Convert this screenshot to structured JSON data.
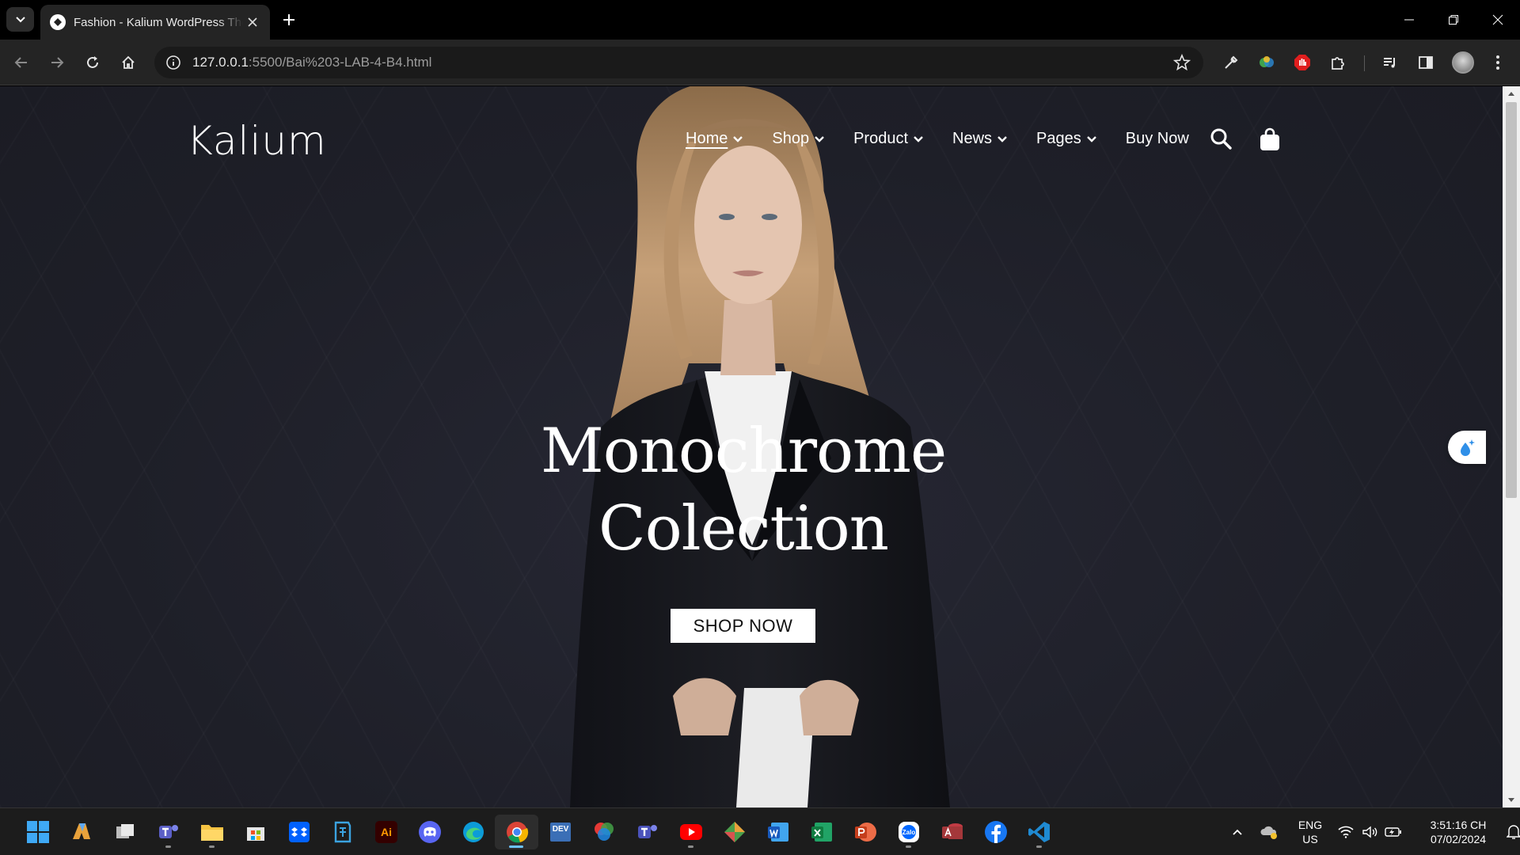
{
  "browser": {
    "tab_title": "Fashion - Kalium WordPress Theme",
    "url_host": "127.0.0.1",
    "url_path": ":5500/Bai%203-LAB-4-B4.html"
  },
  "site": {
    "logo": "Kalium",
    "nav": [
      {
        "label": "Home",
        "dropdown": true,
        "active": true
      },
      {
        "label": "Shop",
        "dropdown": true
      },
      {
        "label": "Product",
        "dropdown": true
      },
      {
        "label": "News",
        "dropdown": true
      },
      {
        "label": "Pages",
        "dropdown": true
      },
      {
        "label": "Buy Now",
        "dropdown": false
      }
    ],
    "hero": {
      "title_line1": "Monochrome",
      "title_line2": "Colection",
      "cta": "SHOP NOW"
    }
  },
  "taskbar": {
    "apps": [
      "windows-start-icon",
      "copilot-icon",
      "task-view-icon",
      "teams-icon",
      "file-explorer-icon",
      "microsoft-store-icon",
      "dropbox-icon",
      "app-icon",
      "illustrator-icon",
      "discord-icon",
      "edge-icon",
      "chrome-icon",
      "devtools-icon",
      "color-app-icon",
      "teams-icon",
      "youtube-icon",
      "git-icon",
      "word-icon",
      "excel-icon",
      "powerpoint-icon",
      "zalo-icon",
      "access-icon",
      "facebook-icon",
      "vscode-icon"
    ],
    "ai_label": "Ai",
    "dev_label": "DEV",
    "zalo_label": "Zalo",
    "language_line1": "ENG",
    "language_line2": "US",
    "time": "3:51:16 CH",
    "date": "07/02/2024"
  },
  "colors": {
    "page_bg": "#1e1f28",
    "accent_blue": "#6cc3ff"
  }
}
